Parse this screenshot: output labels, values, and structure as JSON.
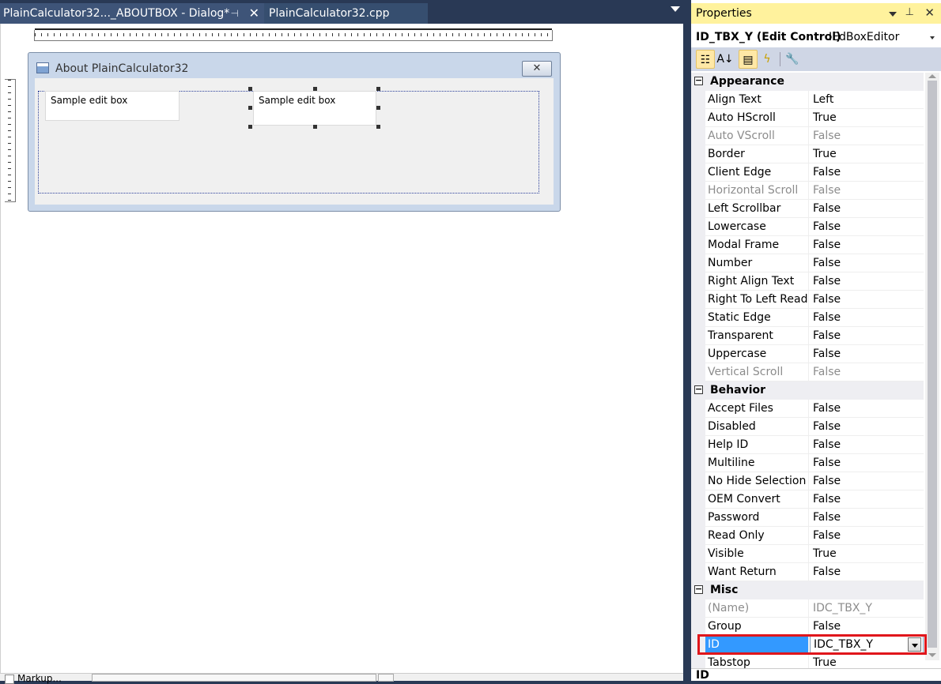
{
  "tabs": [
    {
      "label": "PlainCalculator32..._ABOUTBOX - Dialog*",
      "pin": "⊣",
      "close": "✕"
    },
    {
      "label": "PlainCalculator32.cpp"
    }
  ],
  "dialog": {
    "title": "About PlainCalculator32",
    "close_glyph": "✕",
    "editbox_x_text": "Sample edit box",
    "editbox_y_text": "Sample edit box"
  },
  "bottom": {
    "label": "Markup..."
  },
  "properties": {
    "title": "Properties",
    "object_name": "ID_TBX_Y (Edit Control)",
    "object_type": "IEdBoxEditor",
    "toolbar": {
      "categorized": "☷",
      "alpha": "A↓",
      "properties": "▤",
      "events": "ϟ",
      "pages": "🔧"
    },
    "categories": [
      {
        "name": "Appearance",
        "rows": [
          {
            "name": "Align Text",
            "value": "Left",
            "disabled": false
          },
          {
            "name": "Auto HScroll",
            "value": "True",
            "disabled": false
          },
          {
            "name": "Auto VScroll",
            "value": "False",
            "disabled": true
          },
          {
            "name": "Border",
            "value": "True",
            "disabled": false
          },
          {
            "name": "Client Edge",
            "value": "False",
            "disabled": false
          },
          {
            "name": "Horizontal Scroll",
            "value": "False",
            "disabled": true
          },
          {
            "name": "Left Scrollbar",
            "value": "False",
            "disabled": false
          },
          {
            "name": "Lowercase",
            "value": "False",
            "disabled": false
          },
          {
            "name": "Modal Frame",
            "value": "False",
            "disabled": false
          },
          {
            "name": "Number",
            "value": "False",
            "disabled": false
          },
          {
            "name": "Right Align Text",
            "value": "False",
            "disabled": false
          },
          {
            "name": "Right To Left Readi",
            "value": "False",
            "disabled": false
          },
          {
            "name": "Static Edge",
            "value": "False",
            "disabled": false
          },
          {
            "name": "Transparent",
            "value": "False",
            "disabled": false
          },
          {
            "name": "Uppercase",
            "value": "False",
            "disabled": false
          },
          {
            "name": "Vertical Scroll",
            "value": "False",
            "disabled": true
          }
        ]
      },
      {
        "name": "Behavior",
        "rows": [
          {
            "name": "Accept Files",
            "value": "False",
            "disabled": false
          },
          {
            "name": "Disabled",
            "value": "False",
            "disabled": false
          },
          {
            "name": "Help ID",
            "value": "False",
            "disabled": false
          },
          {
            "name": "Multiline",
            "value": "False",
            "disabled": false
          },
          {
            "name": "No Hide Selection",
            "value": "False",
            "disabled": false
          },
          {
            "name": "OEM Convert",
            "value": "False",
            "disabled": false
          },
          {
            "name": "Password",
            "value": "False",
            "disabled": false
          },
          {
            "name": "Read Only",
            "value": "False",
            "disabled": false
          },
          {
            "name": "Visible",
            "value": "True",
            "disabled": false
          },
          {
            "name": "Want Return",
            "value": "False",
            "disabled": false
          }
        ]
      },
      {
        "name": "Misc",
        "rows": [
          {
            "name": "(Name)",
            "value": "IDC_TBX_Y",
            "disabled": true
          },
          {
            "name": "Group",
            "value": "False",
            "disabled": false
          },
          {
            "name": "ID",
            "value": "IDC_TBX_Y",
            "disabled": false,
            "selected": true
          },
          {
            "name": "Tabstop",
            "value": "True",
            "disabled": false
          }
        ]
      }
    ],
    "description_title": "ID"
  },
  "colors": {
    "selected_row": "#3399ff",
    "highlight_border": "#e0161b",
    "panel_title_bg": "#fff29d"
  }
}
